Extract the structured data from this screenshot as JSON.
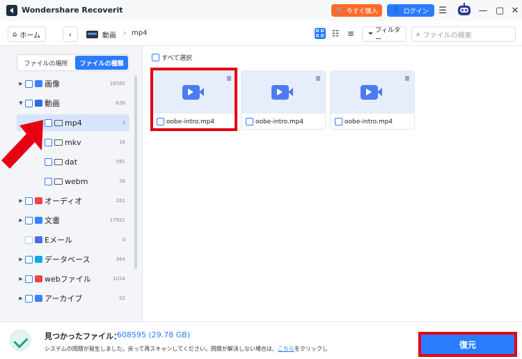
{
  "title_bar": {
    "app_title": "Wondershare Recoverit",
    "buy_label": "今すぐ購入",
    "login_label": "ログイン",
    "icons": [
      "app-logo-icon",
      "cart-icon",
      "user-icon",
      "menu-icon",
      "robot-icon",
      "minimize-icon",
      "maximize-icon",
      "close-icon"
    ]
  },
  "nav": {
    "home_label": "ホーム",
    "breadcrumb": [
      "動画",
      "mp4"
    ],
    "filter_label": "フィルター",
    "search_placeholder": "ファイルの検索"
  },
  "sidebar": {
    "tab_location": "ファイルの場所",
    "tab_type": "ファイルの種類",
    "active_tab": "ファイルの種類",
    "items": [
      {
        "label": "画像",
        "count": "16565",
        "icon_color": "#3b82f6",
        "level": 0,
        "expander": "collapsed"
      },
      {
        "label": "動画",
        "count": "636",
        "icon_color": "#2f6bdc",
        "level": 0,
        "expander": "expanded"
      },
      {
        "label": "mp4",
        "count": "3",
        "level": 1,
        "selected": true
      },
      {
        "label": "mkv",
        "count": "16",
        "level": 1
      },
      {
        "label": "dat",
        "count": "581",
        "level": 1
      },
      {
        "label": "webm",
        "count": "36",
        "level": 1
      },
      {
        "label": "オーディオ",
        "count": "262",
        "icon_color": "#ef4444",
        "level": 0,
        "expander": "collapsed"
      },
      {
        "label": "文書",
        "count": "17951",
        "icon_color": "#3b82f6",
        "level": 0,
        "expander": "collapsed"
      },
      {
        "label": "Eメール",
        "count": "0",
        "icon_color": "#4f6ee8",
        "level": 0,
        "expander": "none"
      },
      {
        "label": "データベース",
        "count": "364",
        "icon_color": "#0ea5e9",
        "level": 0,
        "expander": "collapsed"
      },
      {
        "label": "webファイル",
        "count": "1024",
        "icon_color": "#ef4444",
        "level": 0,
        "expander": "collapsed"
      },
      {
        "label": "アーカイブ",
        "count": "52",
        "icon_color": "#3b82f6",
        "level": 0,
        "expander": "collapsed"
      }
    ]
  },
  "main": {
    "select_all_label": "すべて選択",
    "files": [
      {
        "name": "oobe-intro.mp4",
        "highlighted": true
      },
      {
        "name": "oobe-intro.mp4"
      },
      {
        "name": "oobe-intro.mp4"
      }
    ]
  },
  "footer": {
    "found_label": "見つかったファイル：",
    "found_value": "608595 (29.78 GB)",
    "message": "システムの問題が発生しました。戻って再スキャンしてください。問題が解決しない場合は、",
    "message_link": "こちら",
    "message_tail": "をクリックし",
    "restore_label": "復元"
  },
  "colors": {
    "accent": "#2b7bff",
    "highlight_red": "#e60012",
    "buy_orange": "#ff6a2b"
  }
}
